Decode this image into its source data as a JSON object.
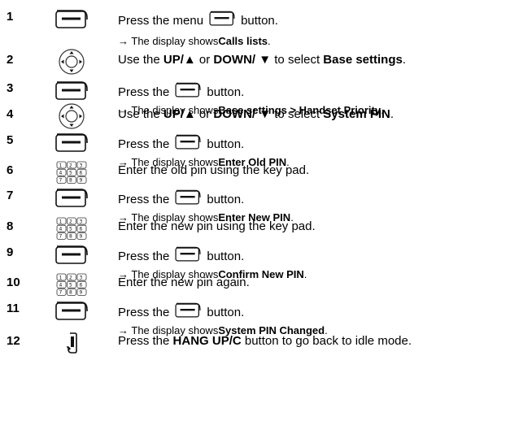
{
  "steps": [
    {
      "num": "1",
      "icon": "softkey-icon",
      "line1": {
        "pre": "Press the menu",
        "post": "button."
      },
      "line2": {
        "pre": "→ The display shows",
        "bold": "Calls lists",
        "post": "."
      }
    },
    {
      "num": "2",
      "icon": "nav-key-icon",
      "parts": [
        {
          "t": "Use the ",
          "b": false
        },
        {
          "t": "UP/▲",
          "b": true
        },
        {
          "t": " or ",
          "b": false
        },
        {
          "t": "DOWN/ ▼",
          "b": true
        },
        {
          "t": " to select ",
          "b": false
        },
        {
          "t": "Base settings",
          "b": true
        },
        {
          "t": ".",
          "b": false
        }
      ]
    },
    {
      "num": "3",
      "icon": "softkey-icon",
      "line1": {
        "pre": "Press the",
        "post": "button."
      },
      "line2": {
        "pre": "→ The display shows",
        "bold": "Base settings > Handset Priority",
        "post": "."
      }
    },
    {
      "num": "4",
      "icon": "nav-key-icon",
      "parts": [
        {
          "t": "Use the ",
          "b": false
        },
        {
          "t": "UP/▲",
          "b": true
        },
        {
          "t": " or ",
          "b": false
        },
        {
          "t": "DOWN/ ▼",
          "b": true
        },
        {
          "t": " to select ",
          "b": false
        },
        {
          "t": "System PIN",
          "b": true
        },
        {
          "t": ".",
          "b": false
        }
      ]
    },
    {
      "num": "5",
      "icon": "softkey-icon",
      "line1": {
        "pre": "Press the",
        "post": "button."
      },
      "line2": {
        "pre": "→ The display shows",
        "bold": "Enter Old PIN",
        "post": "."
      }
    },
    {
      "num": "6",
      "icon": "keypad-icon",
      "parts": [
        {
          "t": "Enter the old pin using the key pad.",
          "b": false
        }
      ]
    },
    {
      "num": "7",
      "icon": "softkey-icon",
      "line1": {
        "pre": "Press the",
        "post": "button."
      },
      "line2": {
        "pre": "→ The display shows",
        "bold": "Enter New PIN",
        "post": "."
      }
    },
    {
      "num": "8",
      "icon": "keypad-icon",
      "parts": [
        {
          "t": "Enter the new pin using the key pad.",
          "b": false
        }
      ]
    },
    {
      "num": "9",
      "icon": "softkey-icon",
      "line1": {
        "pre": "Press the",
        "post": "button."
      },
      "line2": {
        "pre": "→ The display shows",
        "bold": "Confirm New PIN",
        "post": "."
      }
    },
    {
      "num": "10",
      "icon": "keypad-icon",
      "parts": [
        {
          "t": "Enter the new pin again.",
          "b": false
        }
      ]
    },
    {
      "num": "11",
      "icon": "softkey-icon",
      "line1": {
        "pre": "Press the",
        "post": "button."
      },
      "line2": {
        "pre": "→ The display shows",
        "bold": "System PIN Changed",
        "post": "."
      }
    },
    {
      "num": "12",
      "icon": "hang-up-icon",
      "parts": [
        {
          "t": "Press the ",
          "b": false
        },
        {
          "t": "HANG UP/C",
          "b": true
        },
        {
          "t": " button to go back to idle mode.",
          "b": false
        }
      ]
    }
  ]
}
